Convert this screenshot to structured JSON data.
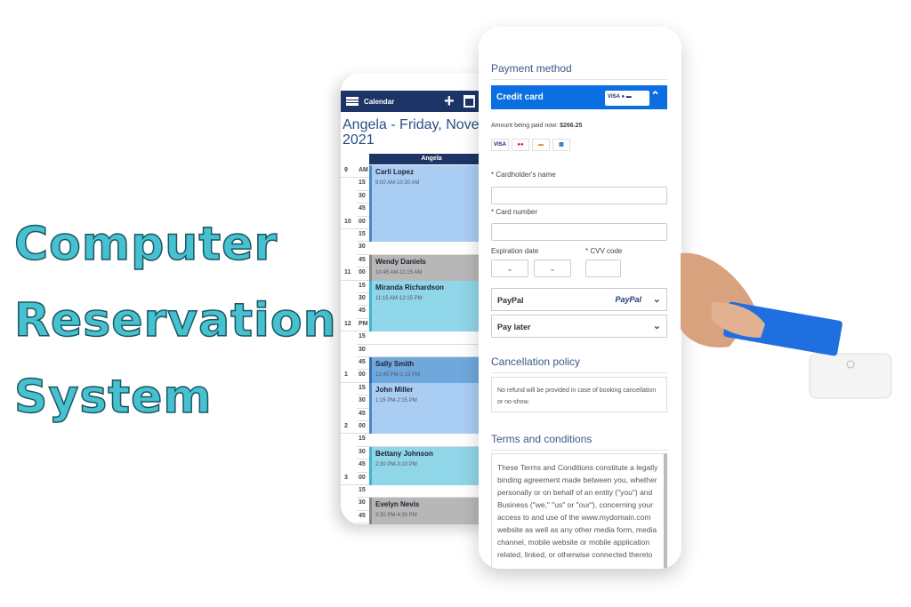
{
  "title": {
    "lines": [
      "Computer",
      "Reservation",
      "System"
    ],
    "color": "#45c1d0"
  },
  "calendar": {
    "app_title": "Calendar",
    "add_icon": "plus-icon",
    "date_icon": "calendar-icon",
    "heading_line1": "Angela - Friday, Novembe",
    "heading_line2": "2021",
    "column": "Angela",
    "slots": [
      [
        "9",
        "AM"
      ],
      [
        "",
        "15"
      ],
      [
        "",
        "30"
      ],
      [
        "",
        "45"
      ],
      [
        "10",
        "00"
      ],
      [
        "",
        "15"
      ],
      [
        "",
        "30"
      ],
      [
        "",
        "45"
      ],
      [
        "11",
        "00"
      ],
      [
        "",
        "15"
      ],
      [
        "",
        "30"
      ],
      [
        "",
        "45"
      ],
      [
        "12",
        "PM"
      ],
      [
        "",
        "15"
      ],
      [
        "",
        "30"
      ],
      [
        "",
        "45"
      ],
      [
        "1",
        "00"
      ],
      [
        "",
        "15"
      ],
      [
        "",
        "30"
      ],
      [
        "",
        "45"
      ],
      [
        "2",
        "00"
      ],
      [
        "",
        "15"
      ],
      [
        "",
        "30"
      ],
      [
        "",
        "45"
      ],
      [
        "3",
        "00"
      ],
      [
        "",
        "15"
      ],
      [
        "",
        "30"
      ],
      [
        "",
        "45"
      ],
      [
        "",
        "00"
      ]
    ],
    "events": [
      {
        "name": "Carli Lopez",
        "time": "9:00 AM-10:30 AM",
        "start": 0,
        "end": 6,
        "color": "#a9cdf3",
        "border": "#4a86c8"
      },
      {
        "name": "Wendy Daniels",
        "time": "10:45 AM-11:15 AM",
        "start": 7,
        "end": 9,
        "color": "#b7b7b7",
        "border": "#888888"
      },
      {
        "name": "Miranda Richardson",
        "time": "11:15 AM-12:15 PM",
        "start": 9,
        "end": 13,
        "color": "#8fd6e8",
        "border": "#3cb4d2"
      },
      {
        "name": "Sally Smith",
        "time": "12:45 PM-1:15 PM",
        "start": 15,
        "end": 17,
        "color": "#6fa8dc",
        "border": "#2d6fb5"
      },
      {
        "name": "John Miller",
        "time": "1:15 PM-2:15 PM",
        "start": 17,
        "end": 21,
        "color": "#a9cdf3",
        "border": "#4a86c8"
      },
      {
        "name": "Bettany Johnson",
        "time": "2:30 PM-3:10 PM",
        "start": 22,
        "end": 25,
        "color": "#8fd6e8",
        "border": "#3cb4d2"
      },
      {
        "name": "Evelyn Nevis",
        "time": "3:30 PM-4:30 PM",
        "start": 26,
        "end": 29,
        "color": "#b7b7b7",
        "border": "#888888"
      }
    ]
  },
  "payment": {
    "heading": "Payment method",
    "credit_card": "Credit card",
    "amount_label": "Amount being paid now:",
    "amount": "$266.25",
    "card_brands": [
      "VISA",
      "MC",
      "DISC",
      "AMEX"
    ],
    "cardholder_label": "* Cardholder's name",
    "card_number_label": "* Card number",
    "expiration_label": "Expiration date",
    "cvv_label": "* CVV code",
    "paypal": "PayPal",
    "paypal_logo": "PayPal",
    "pay_later": "Pay later",
    "cancellation_heading": "Cancellation policy",
    "cancellation_text": "No refund will be provided in case of booking cancellation or no-show.",
    "terms_heading": "Terms and conditions",
    "terms_text": "These Terms and Conditions constitute a legally binding agreement made between you, whether personally or on behalf of an entity (\"you\") and Business (\"we,\" \"us\" or \"our\"), concerning your access to and use of the www.mydomain.com website as well as any other media form, media channel, mobile website or mobile application related, linked, or otherwise connected thereto",
    "accent": "#0a6fe0"
  }
}
